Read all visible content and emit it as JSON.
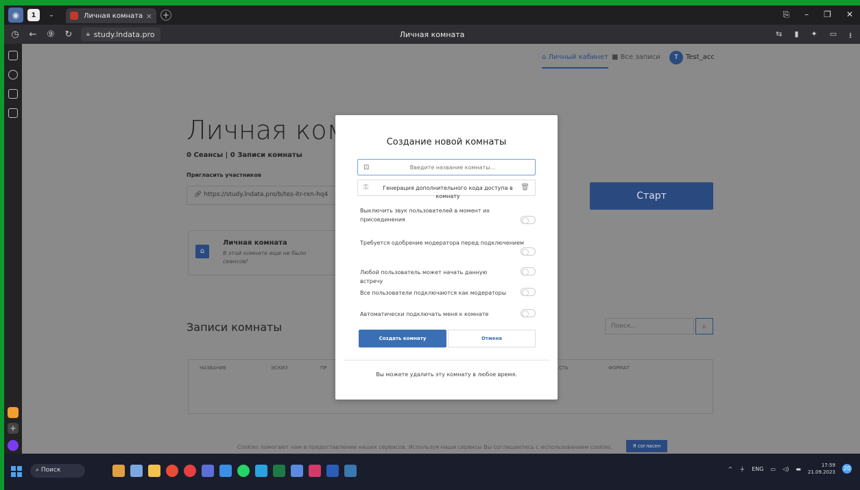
{
  "browser": {
    "tab_title": "Личная комната",
    "tab_count": "1",
    "url": "study.lndata.pro",
    "page_title": "Личная комната"
  },
  "header": {
    "personal_cabinet": "Личный кабинет",
    "all_records": "Все записи",
    "avatar_letter": "T",
    "username": "Test_acc"
  },
  "room": {
    "title": "Личная комна",
    "stats": "0 Сеансы | 0 Записи комнаты",
    "invite_label": "Пригласить участников",
    "invite_url": "https://study.lndata.pro/b/tes-itr-rxn-hq4",
    "start_label": "Старт",
    "card_title": "Личная комната",
    "card_subtitle": "В этой комнате еще не было сеансов!"
  },
  "records": {
    "title": "Записи комнаты",
    "search_placeholder": "Поиск...",
    "columns": [
      "НАЗВАНИЕ",
      "ЭСКИЗ",
      "ПР",
      "СТЬ",
      "ФОРМАТ"
    ]
  },
  "modal": {
    "title": "Создание новой комнаты",
    "name_placeholder": "Введите название комнаты...",
    "generate_code": "Генерация дополнительного кода доступа в комнату",
    "options": [
      "Выключить звук пользователей в момент их присоединения",
      "Требуется одобрение модератора перед подключением",
      "Любой пользователь может начать данную встречу",
      "Все пользователи подключаются как модераторы",
      "Автоматически подключать меня к комнате"
    ],
    "create_label": "Создать комнату",
    "cancel_label": "Отмена",
    "footer": "Вы можете удалить эту комнату в любое время."
  },
  "cookie": {
    "text": "Cookies помогают нам в предоставлении наших сервисов. Используя наши сервисы Вы соглашаетесь с использованием cookies.",
    "accept": "Я согласен"
  },
  "taskbar": {
    "search": "Поиск",
    "lang": "ENG",
    "time": "17:59",
    "date": "21.09.2023",
    "notifications": "20"
  },
  "colors": {
    "accent": "#2a4a7f",
    "primary_button": "#3a6fb5",
    "frame_border": "#0f9a2e"
  }
}
